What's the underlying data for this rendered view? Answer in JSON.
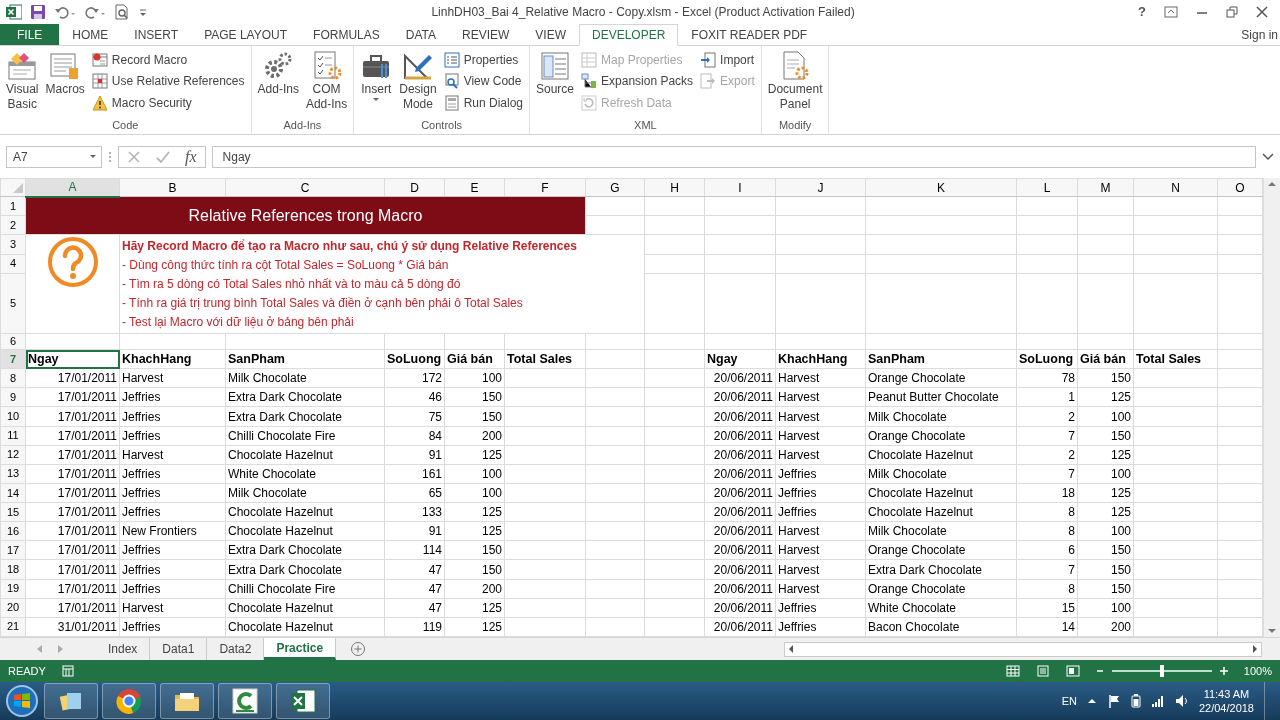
{
  "title_bar": {
    "title": "LinhDH03_Bai 4_Relative Macro - Copy.xlsm - Excel (Product Activation Failed)",
    "help": "?"
  },
  "ribbon_tabs": [
    {
      "label": "FILE",
      "kind": "file",
      "selected": false
    },
    {
      "label": "HOME",
      "kind": "tab",
      "selected": false
    },
    {
      "label": "INSERT",
      "kind": "tab",
      "selected": false
    },
    {
      "label": "PAGE LAYOUT",
      "kind": "tab",
      "selected": false
    },
    {
      "label": "FORMULAS",
      "kind": "tab",
      "selected": false
    },
    {
      "label": "DATA",
      "kind": "tab",
      "selected": false
    },
    {
      "label": "REVIEW",
      "kind": "tab",
      "selected": false
    },
    {
      "label": "VIEW",
      "kind": "tab",
      "selected": false
    },
    {
      "label": "DEVELOPER",
      "kind": "tab",
      "selected": true
    },
    {
      "label": "FOXIT READER PDF",
      "kind": "tab",
      "selected": false
    }
  ],
  "account": "Sign in",
  "ribbon_groups": [
    {
      "label": "Code",
      "items": [
        {
          "label": "Visual\nBasic",
          "kind": "large",
          "disabled": false
        },
        {
          "label": "Macros",
          "kind": "large",
          "disabled": false
        },
        {
          "label": "Record Macro",
          "kind": "small",
          "disabled": false
        },
        {
          "label": "Use Relative References",
          "kind": "small",
          "disabled": false
        },
        {
          "label": "Macro Security",
          "kind": "small",
          "disabled": false
        }
      ]
    },
    {
      "label": "Add-Ins",
      "items": [
        {
          "label": "Add-Ins",
          "kind": "large",
          "disabled": false
        },
        {
          "label": "COM\nAdd-Ins",
          "kind": "large",
          "disabled": false
        }
      ]
    },
    {
      "label": "Controls",
      "items": [
        {
          "label": "Insert",
          "kind": "large",
          "disabled": false,
          "dropdown": true
        },
        {
          "label": "Design\nMode",
          "kind": "large",
          "disabled": false
        },
        {
          "label": "Properties",
          "kind": "small",
          "disabled": false
        },
        {
          "label": "View Code",
          "kind": "small",
          "disabled": false
        },
        {
          "label": "Run Dialog",
          "kind": "small",
          "disabled": false
        }
      ]
    },
    {
      "label": "XML",
      "items": [
        {
          "label": "Source",
          "kind": "large",
          "disabled": false
        },
        {
          "label": "Map Properties",
          "kind": "small",
          "disabled": true
        },
        {
          "label": "Expansion Packs",
          "kind": "small",
          "disabled": false
        },
        {
          "label": "Refresh Data",
          "kind": "small",
          "disabled": true
        },
        {
          "label": "Import",
          "kind": "small",
          "disabled": false
        },
        {
          "label": "Export",
          "kind": "small",
          "disabled": true
        }
      ]
    },
    {
      "label": "Modify",
      "items": [
        {
          "label": "Document\nPanel",
          "kind": "large",
          "disabled": false
        }
      ]
    }
  ],
  "formula_bar": {
    "name_box": "A7",
    "function_label": "fx",
    "formula": "Ngay"
  },
  "sheet": {
    "columns": [
      {
        "label": "A",
        "selected": true
      },
      {
        "label": "B",
        "selected": false
      },
      {
        "label": "C",
        "selected": false
      },
      {
        "label": "D",
        "selected": false
      },
      {
        "label": "E",
        "selected": false
      },
      {
        "label": "F",
        "selected": false
      },
      {
        "label": "G",
        "selected": false
      },
      {
        "label": "H",
        "selected": false
      },
      {
        "label": "I",
        "selected": false
      },
      {
        "label": "J",
        "selected": false
      },
      {
        "label": "K",
        "selected": false
      },
      {
        "label": "L",
        "selected": false
      },
      {
        "label": "M",
        "selected": false
      },
      {
        "label": "N",
        "selected": false
      },
      {
        "label": "O",
        "selected": false
      }
    ],
    "row_numbers": [
      {
        "label": "1",
        "selected": false
      },
      {
        "label": "2",
        "selected": false
      },
      {
        "label": "3",
        "selected": false
      },
      {
        "label": "4",
        "selected": false
      },
      {
        "label": "5",
        "selected": false
      },
      {
        "label": "6",
        "selected": false
      },
      {
        "label": "7",
        "selected": true
      },
      {
        "label": "8",
        "selected": false
      },
      {
        "label": "9",
        "selected": false
      },
      {
        "label": "10",
        "selected": false
      },
      {
        "label": "11",
        "selected": false
      },
      {
        "label": "12",
        "selected": false
      },
      {
        "label": "13",
        "selected": false
      },
      {
        "label": "14",
        "selected": false
      },
      {
        "label": "15",
        "selected": false
      },
      {
        "label": "16",
        "selected": false
      },
      {
        "label": "17",
        "selected": false
      },
      {
        "label": "18",
        "selected": false
      },
      {
        "label": "19",
        "selected": false
      },
      {
        "label": "20",
        "selected": false
      },
      {
        "label": "21",
        "selected": false
      }
    ],
    "banner_title": "Relative References trong Macro",
    "instructions": [
      {
        "text": "Hãy Record Macro để tạo ra Macro như sau, chú ý sử dụng Relative References",
        "bold": true
      },
      {
        "text": "- Dùng công thức tính ra cột Total Sales = SoLuong * Giá bán",
        "bold": false
      },
      {
        "text": "- Tìm ra 5 dòng có Total Sales nhỏ nhất và to màu cả 5 dòng đó",
        "bold": false
      },
      {
        "text": "- Tính ra giá trị trung bình Total Sales và điền ở cạnh bên phải ô Total Sales",
        "bold": false
      },
      {
        "text": "- Test lại Macro với dữ liệu ở bảng bên phải",
        "bold": false
      }
    ],
    "tables": [
      {
        "header": [
          "Ngay",
          "KhachHang",
          "SanPham",
          "SoLuong",
          "Giá bán",
          "Total Sales"
        ],
        "rows": [
          [
            "17/01/2011",
            "Harvest",
            "Milk Chocolate",
            "172",
            "100"
          ],
          [
            "17/01/2011",
            "Jeffries",
            "Extra Dark Chocolate",
            "46",
            "150"
          ],
          [
            "17/01/2011",
            "Jeffries",
            "Extra Dark Chocolate",
            "75",
            "150"
          ],
          [
            "17/01/2011",
            "Jeffries",
            "Chilli Chocolate Fire",
            "84",
            "200"
          ],
          [
            "17/01/2011",
            "Harvest",
            "Chocolate Hazelnut",
            "91",
            "125"
          ],
          [
            "17/01/2011",
            "Jeffries",
            "White Chocolate",
            "161",
            "100"
          ],
          [
            "17/01/2011",
            "Jeffries",
            "Milk Chocolate",
            "65",
            "100"
          ],
          [
            "17/01/2011",
            "Jeffries",
            "Chocolate Hazelnut",
            "133",
            "125"
          ],
          [
            "17/01/2011",
            "New Frontiers",
            "Chocolate Hazelnut",
            "91",
            "125"
          ],
          [
            "17/01/2011",
            "Jeffries",
            "Extra Dark Chocolate",
            "114",
            "150"
          ],
          [
            "17/01/2011",
            "Jeffries",
            "Extra Dark Chocolate",
            "47",
            "150"
          ],
          [
            "17/01/2011",
            "Jeffries",
            "Chilli Chocolate Fire",
            "47",
            "200"
          ],
          [
            "17/01/2011",
            "Harvest",
            "Chocolate Hazelnut",
            "47",
            "125"
          ],
          [
            "31/01/2011",
            "Jeffries",
            "Chocolate Hazelnut",
            "119",
            "125"
          ]
        ]
      },
      {
        "header": [
          "Ngay",
          "KhachHang",
          "SanPham",
          "SoLuong",
          "Giá bán",
          "Total Sales"
        ],
        "rows": [
          [
            "20/06/2011",
            "Harvest",
            "Orange Chocolate",
            "78",
            "150"
          ],
          [
            "20/06/2011",
            "Harvest",
            "Peanut Butter Chocolate",
            "1",
            "125"
          ],
          [
            "20/06/2011",
            "Harvest",
            "Milk Chocolate",
            "2",
            "100"
          ],
          [
            "20/06/2011",
            "Harvest",
            "Orange Chocolate",
            "7",
            "150"
          ],
          [
            "20/06/2011",
            "Harvest",
            "Chocolate Hazelnut",
            "2",
            "125"
          ],
          [
            "20/06/2011",
            "Jeffries",
            "Milk Chocolate",
            "7",
            "100"
          ],
          [
            "20/06/2011",
            "Jeffries",
            "Chocolate Hazelnut",
            "18",
            "125"
          ],
          [
            "20/06/2011",
            "Jeffries",
            "Chocolate Hazelnut",
            "8",
            "125"
          ],
          [
            "20/06/2011",
            "Harvest",
            "Milk Chocolate",
            "8",
            "100"
          ],
          [
            "20/06/2011",
            "Harvest",
            "Orange Chocolate",
            "6",
            "150"
          ],
          [
            "20/06/2011",
            "Harvest",
            "Extra Dark Chocolate",
            "7",
            "150"
          ],
          [
            "20/06/2011",
            "Harvest",
            "Orange Chocolate",
            "8",
            "150"
          ],
          [
            "20/06/2011",
            "Jeffries",
            "White Chocolate",
            "15",
            "100"
          ],
          [
            "20/06/2011",
            "Jeffries",
            "Bacon Chocolate",
            "14",
            "200"
          ]
        ]
      }
    ]
  },
  "sheet_tabs": [
    {
      "label": "Index",
      "selected": false
    },
    {
      "label": "Data1",
      "selected": false
    },
    {
      "label": "Data2",
      "selected": false
    },
    {
      "label": "Practice",
      "selected": true
    }
  ],
  "status_bar": {
    "mode": "READY",
    "zoom": {
      "reading": "100%",
      "level": 0.5
    }
  },
  "taskbar": {
    "language": "EN",
    "time": "11:43 AM",
    "date": "22/04/2018"
  }
}
